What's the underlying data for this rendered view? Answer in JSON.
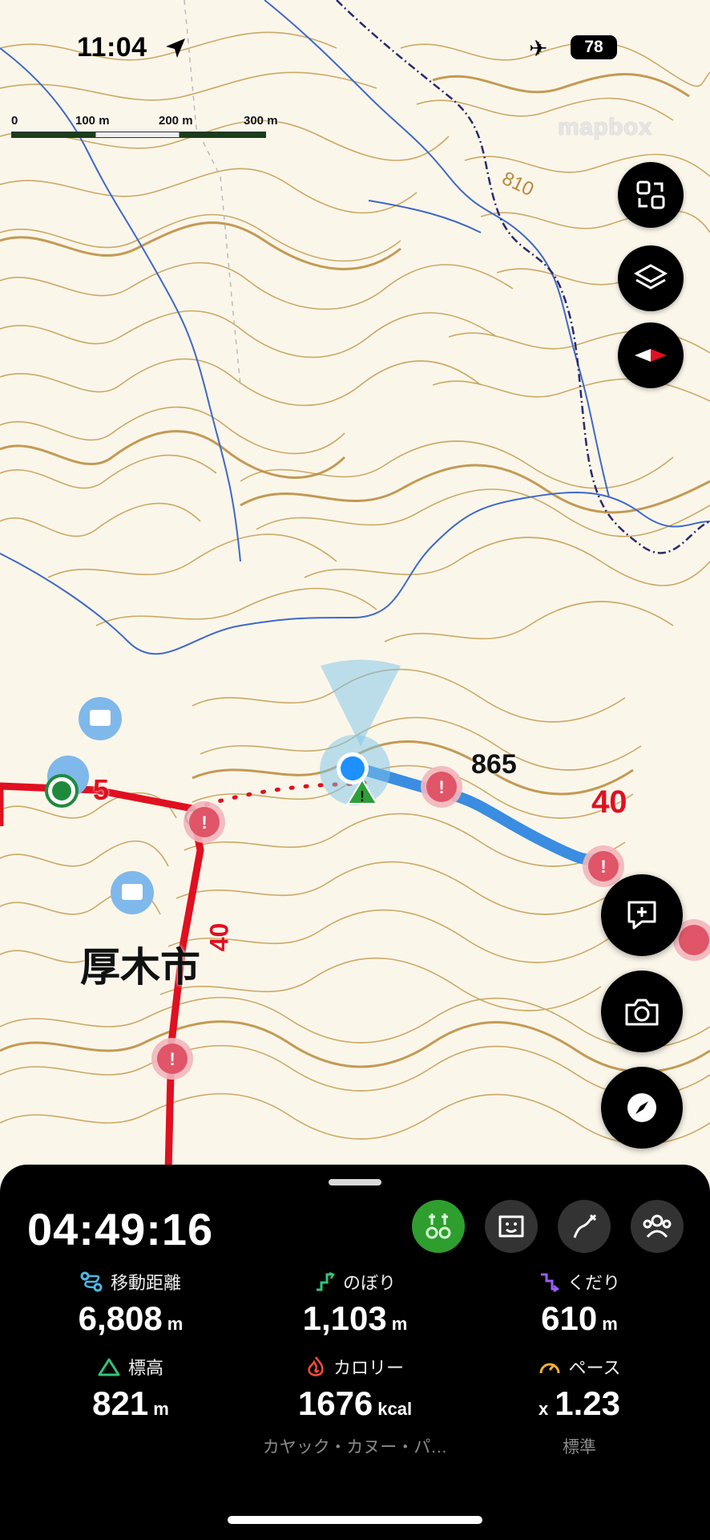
{
  "status_bar": {
    "time": "11:04",
    "battery": "78"
  },
  "scale_bar": {
    "labels": [
      "0",
      "100 m",
      "200 m",
      "300 m"
    ]
  },
  "attribution": "mapbox",
  "map": {
    "place_name": "厚木市",
    "peak_elevation": "865",
    "contour_label": "810",
    "route_numbers": [
      "5",
      "40",
      "40"
    ]
  },
  "map_controls": [
    "fit-view-icon",
    "layers-icon",
    "compass-heading-icon",
    "add-note-icon",
    "camera-icon",
    "compass-icon"
  ],
  "tracking": {
    "elapsed_time": "04:49:16",
    "modes": [
      "navigation-mode",
      "face-mode",
      "route-mode",
      "group-mode"
    ],
    "stats": [
      {
        "label": "移動距離",
        "value": "6,808",
        "unit": "m",
        "icon_color": "#4fb8e6"
      },
      {
        "label": "のぼり",
        "value": "1,103",
        "unit": "m",
        "icon_color": "#2fc67a"
      },
      {
        "label": "くだり",
        "value": "610",
        "unit": "m",
        "icon_color": "#9a5cff"
      },
      {
        "label": "標高",
        "value": "821",
        "unit": "m",
        "icon_color": "#2fc67a"
      },
      {
        "label": "カロリー",
        "value": "1676",
        "unit": "kcal",
        "icon_color": "#ff4d3a"
      },
      {
        "label": "ペース",
        "value": "1.23",
        "prefix": "x",
        "icon_color": "#f0b030"
      }
    ],
    "activity_type": "カヤック・カヌー・パ…",
    "pace_level": "標準"
  },
  "colors": {
    "route_red": "#e01020",
    "track_blue": "#3a8de0",
    "contour": "#c6a25a",
    "active_mode": "#2e9e2e"
  }
}
